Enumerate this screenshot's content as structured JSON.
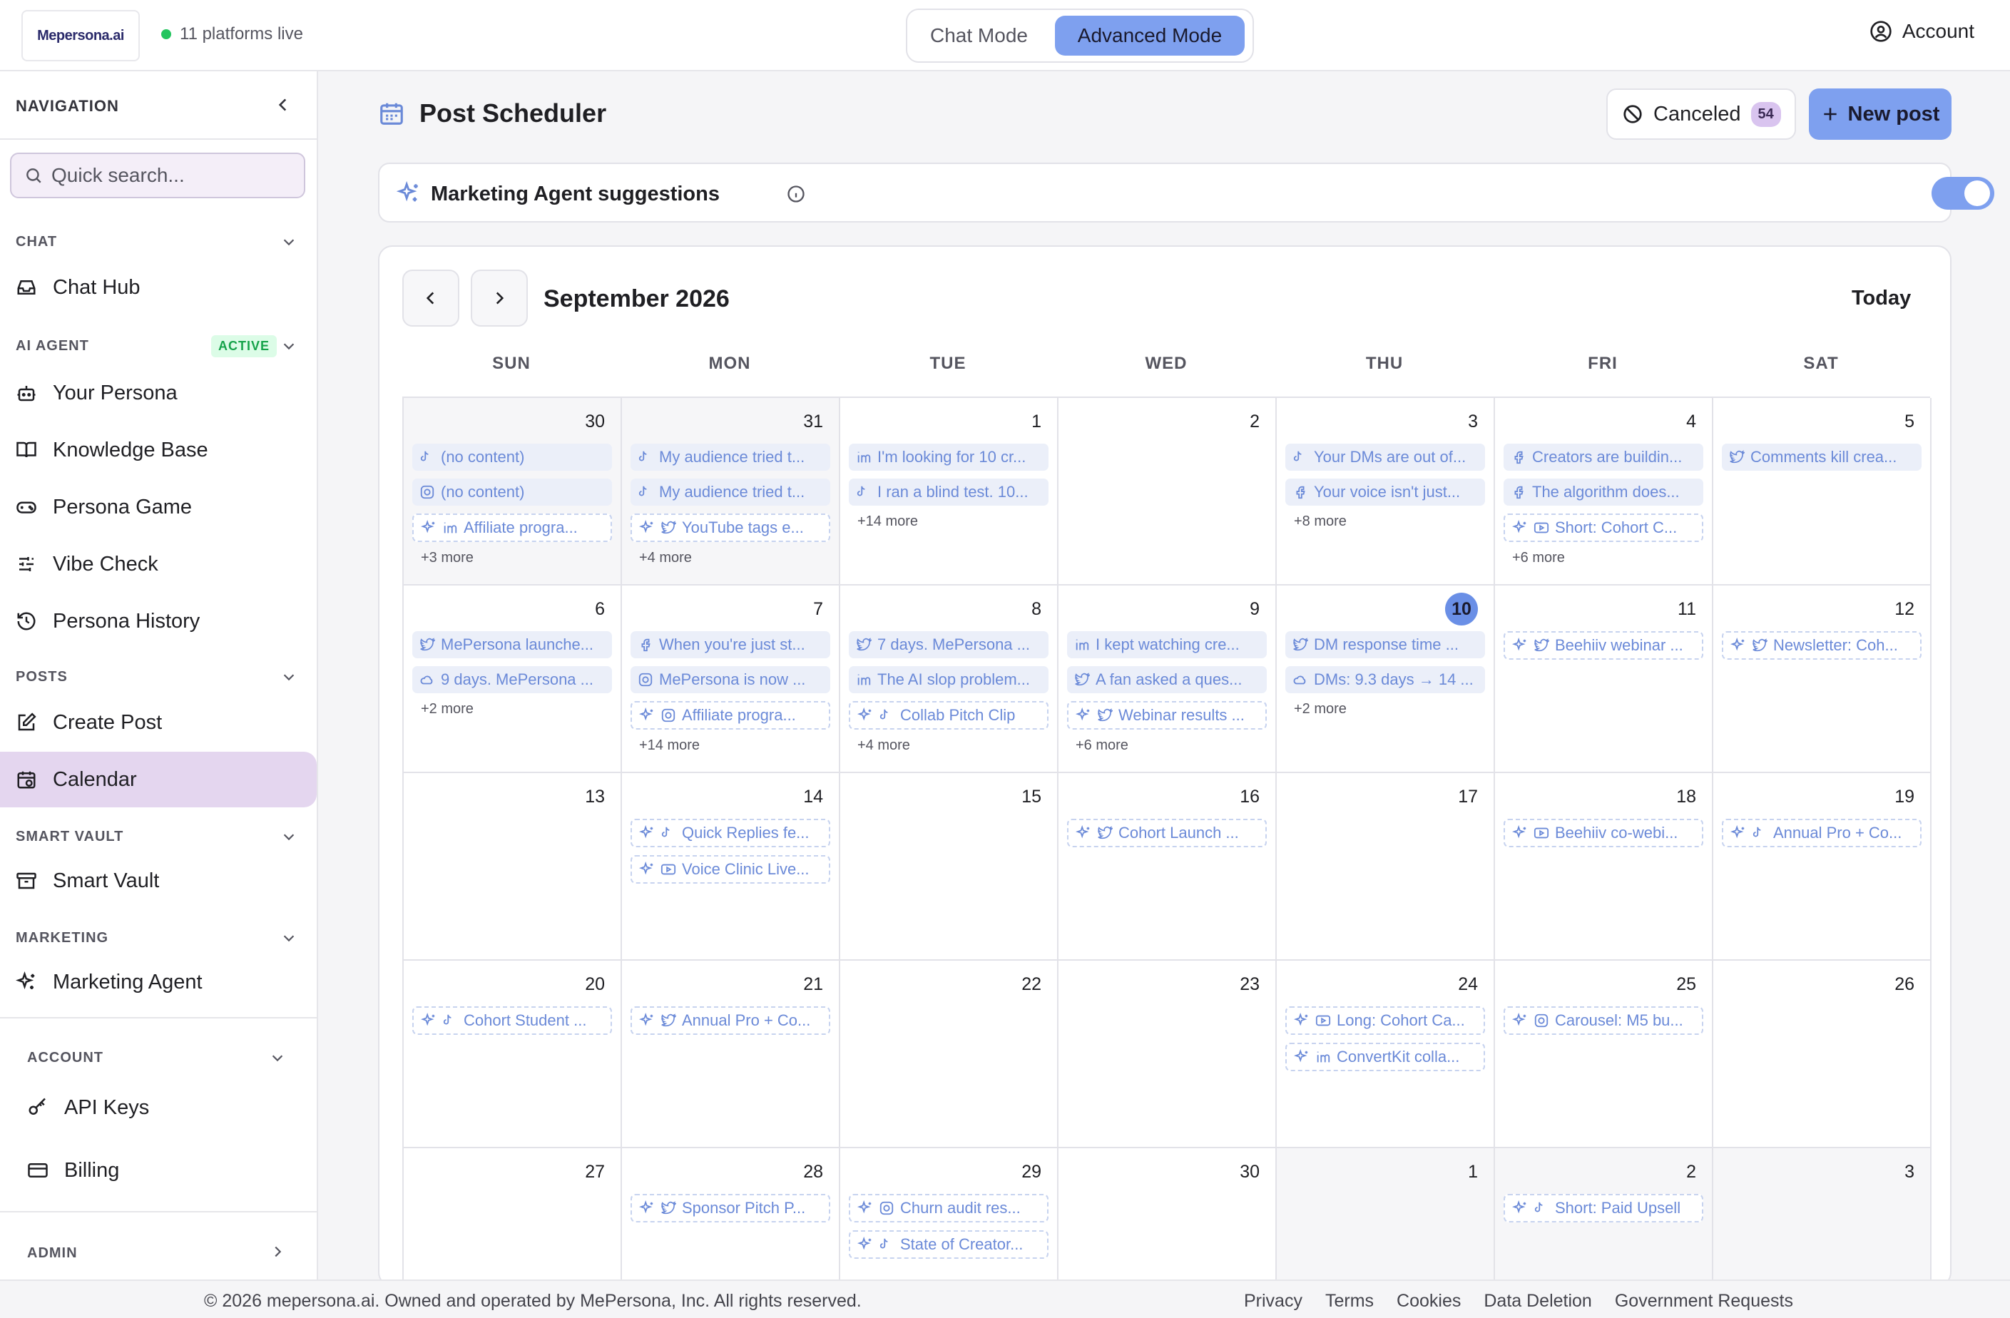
{
  "topbar": {
    "logo_text": "Mepersona.ai",
    "platforms_status": "11 platforms live",
    "chat_mode_label": "Chat Mode",
    "advanced_mode_label": "Advanced Mode",
    "account_label": "Account"
  },
  "sidebar": {
    "nav_title": "NAVIGATION",
    "search_placeholder": "Quick search...",
    "chat_section": "CHAT",
    "chat_hub": "Chat Hub",
    "ai_agent_section": "AI AGENT",
    "active_badge": "ACTIVE",
    "your_persona": "Your Persona",
    "knowledge_base": "Knowledge Base",
    "persona_game": "Persona Game",
    "vibe_check": "Vibe Check",
    "persona_history": "Persona History",
    "posts_section": "POSTS",
    "create_post": "Create Post",
    "calendar": "Calendar",
    "smart_vault_section": "SMART VAULT",
    "smart_vault": "Smart Vault",
    "marketing_section": "MARKETING",
    "marketing_agent": "Marketing Agent",
    "account_section": "ACCOUNT",
    "api_keys": "API Keys",
    "billing": "Billing",
    "admin_section": "ADMIN"
  },
  "main": {
    "page_title": "Post Scheduler",
    "canceled_label": "Canceled",
    "canceled_count": "54",
    "new_post_label": "New post",
    "suggestions_label": "Marketing Agent suggestions",
    "suggestions_enabled": true
  },
  "calendar": {
    "month_label": "September 2026",
    "today_label": "Today",
    "weekdays": [
      "SUN",
      "MON",
      "TUE",
      "WED",
      "THU",
      "FRI",
      "SAT"
    ],
    "colors": {
      "event_text": "#6b8ad8",
      "event_bg": "#ebeff9",
      "today_circle": "#6a8fe6",
      "accent": "#7ea0ef"
    },
    "days": [
      {
        "d": "30",
        "other": true,
        "events": [
          {
            "p": "tiktok",
            "t": "(no content)"
          },
          {
            "p": "instagram",
            "t": "(no content)"
          },
          {
            "p": "linkedin",
            "t": "Affiliate progra...",
            "s": true
          }
        ],
        "more": "+3 more"
      },
      {
        "d": "31",
        "other": true,
        "events": [
          {
            "p": "tiktok",
            "t": "My audience tried t..."
          },
          {
            "p": "tiktok",
            "t": "My audience tried t..."
          },
          {
            "p": "twitter",
            "t": "YouTube tags e...",
            "s": true
          }
        ],
        "more": "+4 more"
      },
      {
        "d": "1",
        "events": [
          {
            "p": "linkedin",
            "t": "I'm looking for 10 cr..."
          },
          {
            "p": "tiktok",
            "t": "I ran a blind test. 10..."
          }
        ],
        "more": "+14 more"
      },
      {
        "d": "2",
        "events": []
      },
      {
        "d": "3",
        "events": [
          {
            "p": "tiktok",
            "t": "Your DMs are out of..."
          },
          {
            "p": "facebook",
            "t": "Your voice isn't just..."
          }
        ],
        "more": "+8 more"
      },
      {
        "d": "4",
        "events": [
          {
            "p": "facebook",
            "t": "Creators are buildin..."
          },
          {
            "p": "facebook",
            "t": "The algorithm does..."
          },
          {
            "p": "youtube",
            "t": "Short: Cohort C...",
            "s": true
          }
        ],
        "more": "+6 more"
      },
      {
        "d": "5",
        "events": [
          {
            "p": "twitter",
            "t": "Comments kill crea..."
          }
        ]
      },
      {
        "d": "6",
        "events": [
          {
            "p": "twitter",
            "t": "MePersona launche..."
          },
          {
            "p": "threads",
            "t": "9 days. MePersona ..."
          }
        ],
        "more": "+2 more"
      },
      {
        "d": "7",
        "events": [
          {
            "p": "facebook",
            "t": "When you're just st..."
          },
          {
            "p": "instagram",
            "t": "MePersona is now ..."
          },
          {
            "p": "instagram",
            "t": "Affiliate progra...",
            "s": true
          }
        ],
        "more": "+14 more"
      },
      {
        "d": "8",
        "events": [
          {
            "p": "twitter",
            "t": "7 days. MePersona ..."
          },
          {
            "p": "linkedin",
            "t": "The AI slop problem..."
          },
          {
            "p": "tiktok",
            "t": "Collab Pitch Clip",
            "s": true
          }
        ],
        "more": "+4 more"
      },
      {
        "d": "9",
        "events": [
          {
            "p": "linkedin",
            "t": "I kept watching cre..."
          },
          {
            "p": "twitter",
            "t": "A fan asked a ques..."
          },
          {
            "p": "twitter",
            "t": "Webinar results ...",
            "s": true
          }
        ],
        "more": "+6 more"
      },
      {
        "d": "10",
        "today": true,
        "events": [
          {
            "p": "twitter",
            "t": "DM response time ..."
          },
          {
            "p": "threads",
            "t": "DMs: 9.3 days → 14 ..."
          }
        ],
        "more": "+2 more"
      },
      {
        "d": "11",
        "events": [
          {
            "p": "twitter",
            "t": "Beehiiv webinar ...",
            "s": true
          }
        ]
      },
      {
        "d": "12",
        "events": [
          {
            "p": "twitter",
            "t": "Newsletter: Coh...",
            "s": true
          }
        ]
      },
      {
        "d": "13",
        "events": []
      },
      {
        "d": "14",
        "events": [
          {
            "p": "tiktok",
            "t": "Quick Replies fe...",
            "s": true
          },
          {
            "p": "youtube",
            "t": "Voice Clinic Live...",
            "s": true
          }
        ]
      },
      {
        "d": "15",
        "events": []
      },
      {
        "d": "16",
        "events": [
          {
            "p": "twitter",
            "t": "Cohort Launch ...",
            "s": true
          }
        ]
      },
      {
        "d": "17",
        "events": []
      },
      {
        "d": "18",
        "events": [
          {
            "p": "youtube",
            "t": "Beehiiv co-webi...",
            "s": true
          }
        ]
      },
      {
        "d": "19",
        "events": [
          {
            "p": "tiktok",
            "t": "Annual Pro + Co...",
            "s": true
          }
        ]
      },
      {
        "d": "20",
        "events": [
          {
            "p": "tiktok",
            "t": "Cohort Student ...",
            "s": true
          }
        ]
      },
      {
        "d": "21",
        "events": [
          {
            "p": "twitter",
            "t": "Annual Pro + Co...",
            "s": true
          }
        ]
      },
      {
        "d": "22",
        "events": []
      },
      {
        "d": "23",
        "events": []
      },
      {
        "d": "24",
        "events": [
          {
            "p": "youtube",
            "t": "Long: Cohort Ca...",
            "s": true
          },
          {
            "p": "linkedin",
            "t": "ConvertKit colla...",
            "s": true
          }
        ]
      },
      {
        "d": "25",
        "events": [
          {
            "p": "instagram",
            "t": "Carousel: M5 bu...",
            "s": true
          }
        ]
      },
      {
        "d": "26",
        "events": []
      },
      {
        "d": "27",
        "events": []
      },
      {
        "d": "28",
        "events": [
          {
            "p": "twitter",
            "t": "Sponsor Pitch P...",
            "s": true
          }
        ]
      },
      {
        "d": "29",
        "events": [
          {
            "p": "instagram",
            "t": "Churn audit res...",
            "s": true
          },
          {
            "p": "tiktok",
            "t": "State of Creator...",
            "s": true
          }
        ]
      },
      {
        "d": "30",
        "events": []
      },
      {
        "d": "1",
        "other": true,
        "events": []
      },
      {
        "d": "2",
        "other": true,
        "events": [
          {
            "p": "tiktok",
            "t": "Short: Paid Upsell",
            "s": true
          }
        ]
      },
      {
        "d": "3",
        "other": true,
        "events": []
      }
    ]
  },
  "footer": {
    "copyright": "© 2026 mepersona.ai. Owned and operated by MePersona, Inc. All rights reserved.",
    "privacy": "Privacy",
    "terms": "Terms",
    "cookies": "Cookies",
    "data_deletion": "Data Deletion",
    "government_requests": "Government Requests"
  }
}
